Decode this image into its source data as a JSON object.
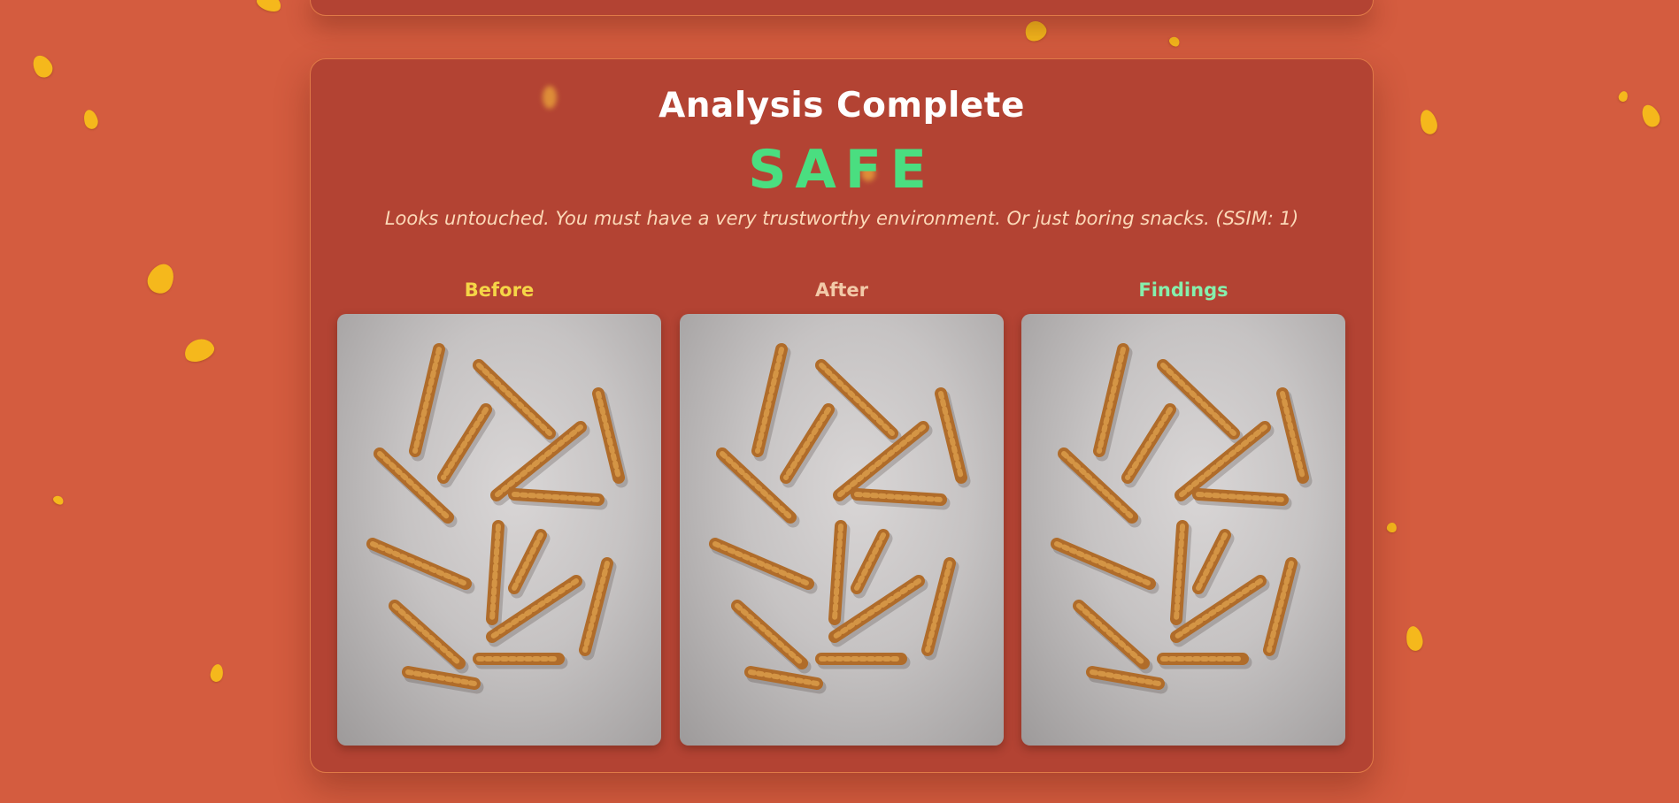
{
  "result": {
    "title": "Analysis Complete",
    "verdict": "SAFE",
    "message": "Looks untouched. You must have a very trustworthy environment. Or just boring snacks. (SSIM: 1)"
  },
  "columns": [
    {
      "label": "Before",
      "color": "#f5d547"
    },
    {
      "label": "After",
      "color": "#f2c9a8"
    },
    {
      "label": "Findings",
      "color": "#86efac"
    }
  ],
  "colors": {
    "background": "#d45c3f",
    "card": "#b34333",
    "card_border": "#e07a47",
    "verdict_safe": "#4ade80",
    "snack": "#f5b81c"
  },
  "icons": {
    "background_decor": "falling-cheese-puff-icon"
  }
}
